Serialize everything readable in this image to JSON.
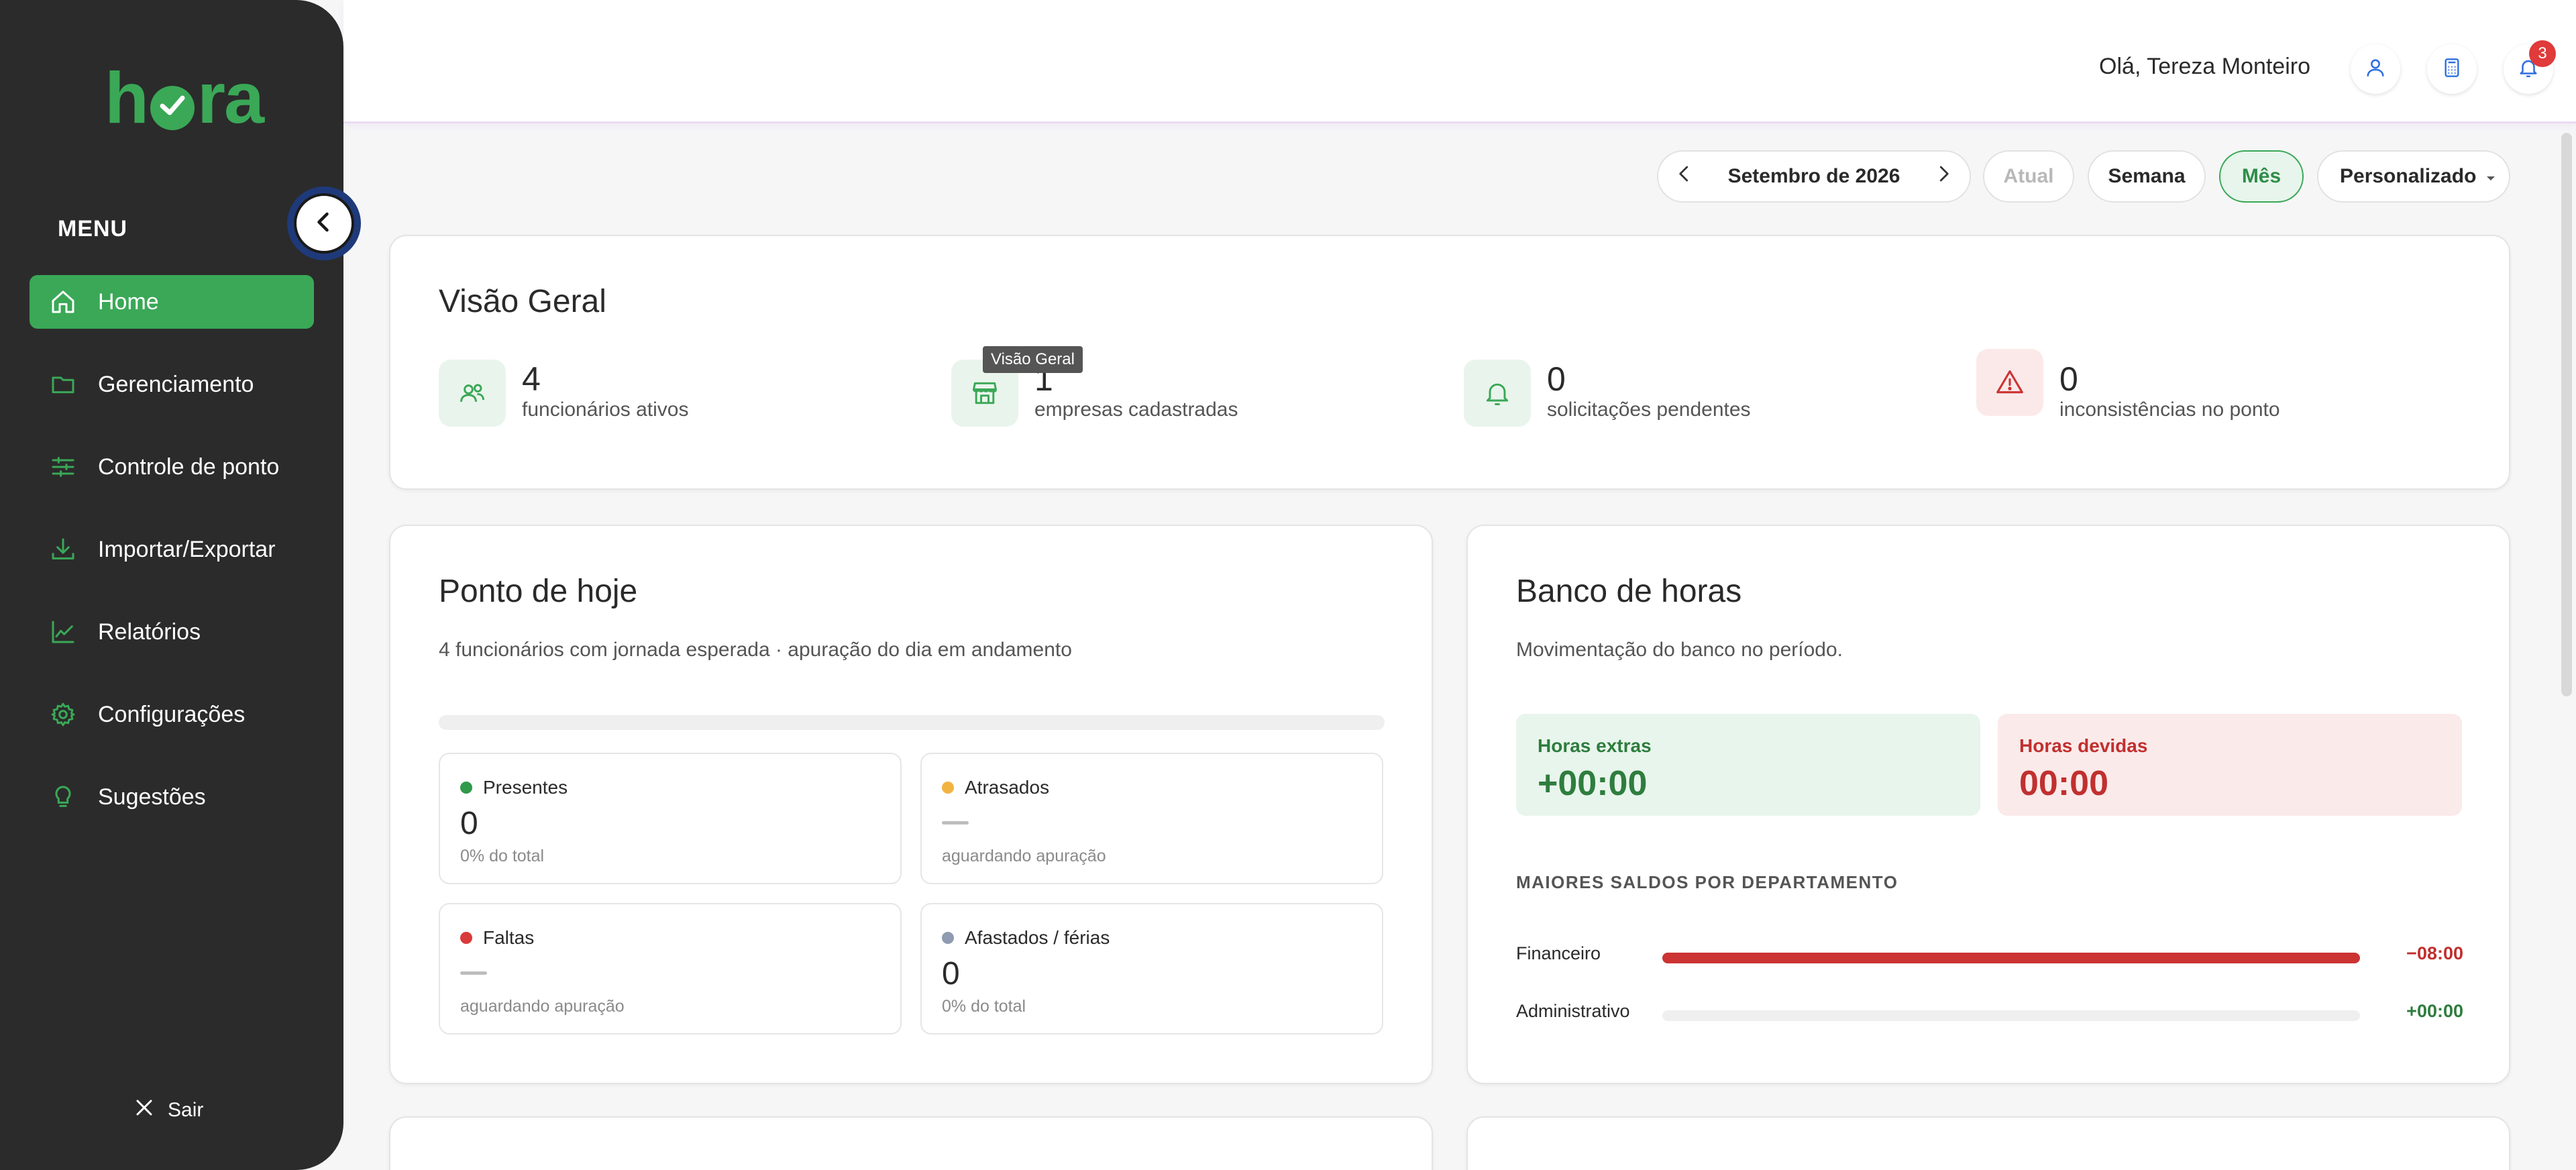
{
  "app": {
    "logo": "hora"
  },
  "sidebar": {
    "menu_label": "MENU",
    "items": [
      {
        "label": "Home",
        "icon": "home-icon",
        "active": true
      },
      {
        "label": "Gerenciamento",
        "icon": "folder-icon"
      },
      {
        "label": "Controle de ponto",
        "icon": "sliders-icon"
      },
      {
        "label": "Importar/Exportar",
        "icon": "download-icon"
      },
      {
        "label": "Relatórios",
        "icon": "chart-line-icon"
      },
      {
        "label": "Configurações",
        "icon": "gear-icon"
      },
      {
        "label": "Sugestões",
        "icon": "lightbulb-icon"
      }
    ],
    "logout_label": "Sair"
  },
  "header": {
    "greeting": "Olá, Tereza Monteiro",
    "notifications_count": "3"
  },
  "toolbar": {
    "period_label": "Setembro de 2026",
    "atual_label": "Atual",
    "semana_label": "Semana",
    "mes_label": "Mês",
    "personalizado_label": "Personalizado"
  },
  "overview": {
    "title": "Visão Geral",
    "tooltip": "Visão Geral",
    "stats": [
      {
        "value": "4",
        "label": "funcionários ativos",
        "icon": "users-icon"
      },
      {
        "value": "1",
        "label": "empresas cadastradas",
        "icon": "store-icon"
      },
      {
        "value": "0",
        "label": "solicitações pendentes",
        "icon": "bell-icon"
      },
      {
        "value": "0",
        "label": "inconsistências no ponto",
        "icon": "warning-icon"
      }
    ]
  },
  "today": {
    "title": "Ponto de hoje",
    "subtitle": "4 funcionários com jornada esperada · apuração do dia em andamento",
    "cards": {
      "presentes": {
        "label": "Presentes",
        "value": "0",
        "foot": "0% do total"
      },
      "atrasados": {
        "label": "Atrasados",
        "foot": "aguardando apuração"
      },
      "faltas": {
        "label": "Faltas",
        "foot": "aguardando apuração"
      },
      "afastados": {
        "label": "Afastados / férias",
        "value": "0",
        "foot": "0% do total"
      }
    }
  },
  "bank": {
    "title": "Banco de horas",
    "subtitle": "Movimentação do banco no período.",
    "extras_label": "Horas extras",
    "extras_value": "+00:00",
    "devidas_label": "Horas devidas",
    "devidas_value": "00:00",
    "section_caption": "MAIORES SALDOS POR DEPARTAMENTO",
    "departments": [
      {
        "name": "Financeiro",
        "amount": "−08:00",
        "fraction": 1.0
      },
      {
        "name": "Administrativo",
        "amount": "+00:00",
        "fraction": 0.0
      }
    ]
  },
  "colors": {
    "brand_green": "#3aa857",
    "danger_red": "#cc3333",
    "warning_amber": "#f2b440",
    "neutral_gray": "#8e9bb0"
  }
}
